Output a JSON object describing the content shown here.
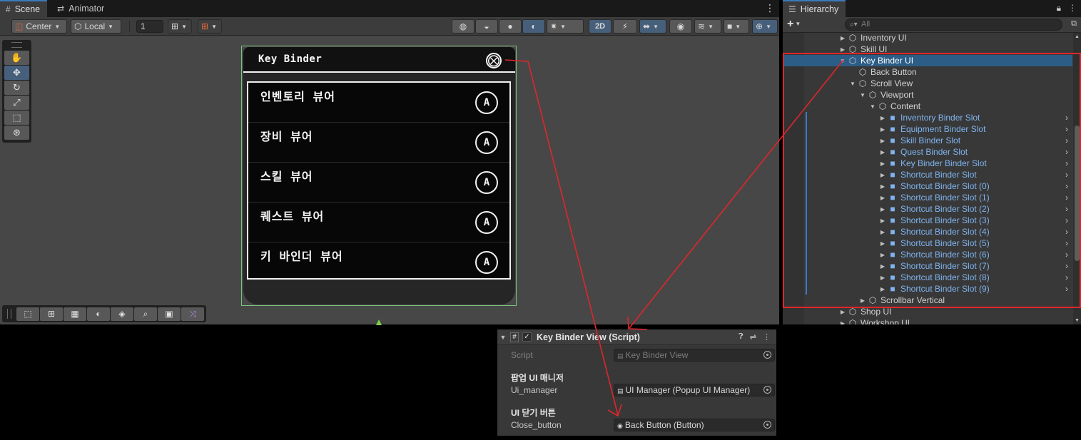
{
  "scene": {
    "tabs": [
      {
        "label": "Scene",
        "icon": "grid-icon"
      },
      {
        "label": "Animator",
        "icon": "animator-icon"
      }
    ],
    "toolbar": {
      "pivot": "Center",
      "space": "Local",
      "grid_size": "1",
      "mode_2d": "2D"
    },
    "tools": [
      "hand",
      "move",
      "rotate",
      "scale",
      "rect",
      "transform"
    ],
    "overlays": [
      "rect",
      "anchor",
      "grid",
      "shading",
      "layers",
      "search",
      "camera",
      "shuffle"
    ]
  },
  "key_binder": {
    "title": "Key Binder",
    "close_glyph": "⨂",
    "items": [
      {
        "label": "인벤토리 뷰어",
        "key": "A"
      },
      {
        "label": "장비 뷰어",
        "key": "A"
      },
      {
        "label": "스킬 뷰어",
        "key": "A"
      },
      {
        "label": "퀘스트 뷰어",
        "key": "A"
      },
      {
        "label": "키 바인더 뷰어",
        "key": "A"
      }
    ]
  },
  "hierarchy": {
    "tab": "Hierarchy",
    "search_placeholder": "All",
    "add_label": "+",
    "rows": [
      {
        "label": "Inventory UI",
        "depth": 0,
        "arrow": "▶",
        "prefab": false
      },
      {
        "label": "Skill UI",
        "depth": 0,
        "arrow": "▶",
        "prefab": false
      },
      {
        "label": "Key Binder UI",
        "depth": 0,
        "arrow": "▼",
        "prefab": false,
        "selected": true
      },
      {
        "label": "Back Button",
        "depth": 1,
        "arrow": "",
        "prefab": false
      },
      {
        "label": "Scroll View",
        "depth": 1,
        "arrow": "▼",
        "prefab": false
      },
      {
        "label": "Viewport",
        "depth": 2,
        "arrow": "▼",
        "prefab": false
      },
      {
        "label": "Content",
        "depth": 3,
        "arrow": "▼",
        "prefab": false
      },
      {
        "label": "Inventory Binder Slot",
        "depth": 4,
        "arrow": "▶",
        "prefab": true
      },
      {
        "label": "Equipment Binder Slot",
        "depth": 4,
        "arrow": "▶",
        "prefab": true
      },
      {
        "label": "Skill Binder Slot",
        "depth": 4,
        "arrow": "▶",
        "prefab": true
      },
      {
        "label": "Quest Binder Slot",
        "depth": 4,
        "arrow": "▶",
        "prefab": true
      },
      {
        "label": "Key Binder Binder Slot",
        "depth": 4,
        "arrow": "▶",
        "prefab": true
      },
      {
        "label": "Shortcut Binder Slot",
        "depth": 4,
        "arrow": "▶",
        "prefab": true
      },
      {
        "label": "Shortcut Binder Slot (0)",
        "depth": 4,
        "arrow": "▶",
        "prefab": true
      },
      {
        "label": "Shortcut Binder Slot (1)",
        "depth": 4,
        "arrow": "▶",
        "prefab": true
      },
      {
        "label": "Shortcut Binder Slot (2)",
        "depth": 4,
        "arrow": "▶",
        "prefab": true
      },
      {
        "label": "Shortcut Binder Slot (3)",
        "depth": 4,
        "arrow": "▶",
        "prefab": true
      },
      {
        "label": "Shortcut Binder Slot (4)",
        "depth": 4,
        "arrow": "▶",
        "prefab": true
      },
      {
        "label": "Shortcut Binder Slot (5)",
        "depth": 4,
        "arrow": "▶",
        "prefab": true
      },
      {
        "label": "Shortcut Binder Slot (6)",
        "depth": 4,
        "arrow": "▶",
        "prefab": true
      },
      {
        "label": "Shortcut Binder Slot (7)",
        "depth": 4,
        "arrow": "▶",
        "prefab": true
      },
      {
        "label": "Shortcut Binder Slot (8)",
        "depth": 4,
        "arrow": "▶",
        "prefab": true
      },
      {
        "label": "Shortcut Binder Slot (9)",
        "depth": 4,
        "arrow": "▶",
        "prefab": true
      },
      {
        "label": "Scrollbar Vertical",
        "depth": 2,
        "arrow": "▶",
        "prefab": false
      },
      {
        "label": "Shop UI",
        "depth": 0,
        "arrow": "▶",
        "prefab": false
      },
      {
        "label": "Workshop UI",
        "depth": 0,
        "arrow": "▶",
        "prefab": false
      }
    ]
  },
  "inspector": {
    "component_title": "Key Binder View (Script)",
    "script_label": "Script",
    "script_value": "Key Binder View",
    "header_manager": "팝업 UI 매니저",
    "manager_label": "Ui_manager",
    "manager_value": "UI Manager (Popup UI Manager)",
    "header_close": "UI 닫기 버튼",
    "close_label": "Close_button",
    "close_value": "Back Button (Button)"
  },
  "colors": {
    "annotation_red": "#e0262a",
    "selection_blue": "#2c5d87",
    "prefab_blue": "#7fb4ef",
    "frame_green": "#7cc37c"
  }
}
